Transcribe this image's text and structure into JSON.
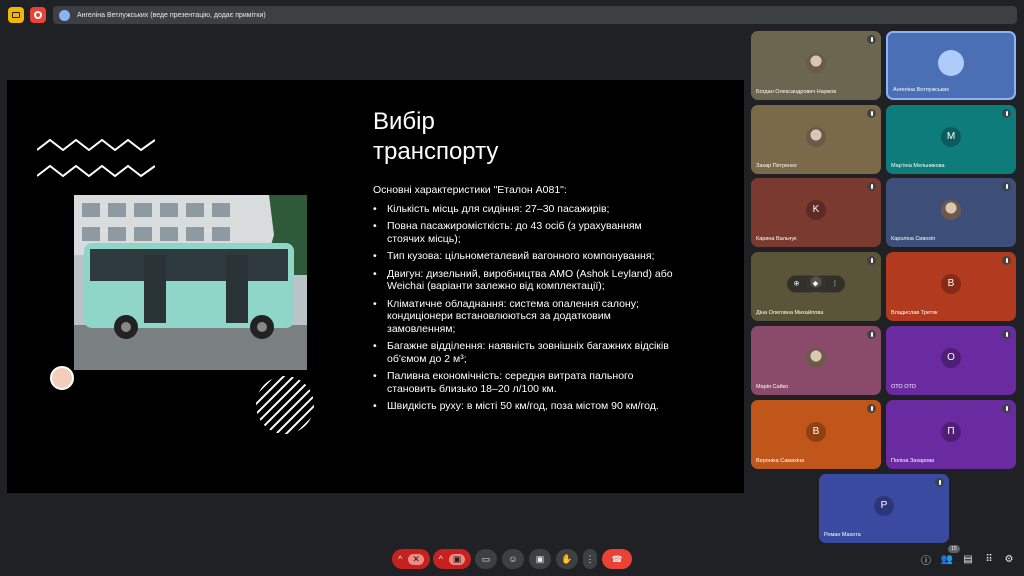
{
  "header": {
    "presenting_text": "Ангеліна Ветлужських (веде презентацію, додає примітки)"
  },
  "slide": {
    "title_line1": "Вибір",
    "title_line2": "транспорту",
    "intro": "Основні характеристики \"Еталон А081\":",
    "bullets": [
      "Кількість місць для сидіння: 27–30 пасажирів;",
      "Повна пасажиромісткість: до 43 осіб (з урахуванням стоячих місць);",
      "Тип кузова: цільнометалевий вагонного компонування;",
      "Двигун: дизельний, виробництва АМО (Ashok Leyland) або Weichai (варіанти залежно від комплектації);",
      "Кліматичне обладнання: система опалення салону; кондиціонери встановлюються за додатковим замовленням;",
      "Багажне відділення: наявність зовнішніх багажних відсіків об'ємом до 2 м³;",
      "Паливна економічність: середня витрата пального становить близько 18–20 л/100 км.",
      "Швидкість руху: в місті  50 км/год, поза містом 90 км/год."
    ]
  },
  "participants": [
    {
      "name": "Богдан Олександрович Наумов",
      "initial": "",
      "color": "#6b6650"
    },
    {
      "name": "Ангеліна Ветлужських",
      "initial": "",
      "color": "#4a6fb5"
    },
    {
      "name": "Захар Петренко",
      "initial": "",
      "color": "#7a6a4a"
    },
    {
      "name": "Мар'яна Мельникова",
      "initial": "M",
      "color": "#0f7c7c"
    },
    {
      "name": "Карина Вальчук",
      "initial": "K",
      "color": "#7b3a2f"
    },
    {
      "name": "Кароліна Сивохіп",
      "initial": "",
      "color": "#3d4f78"
    },
    {
      "name": "Діна Олеговна Михайлова",
      "initial": "",
      "color": "#5a5538"
    },
    {
      "name": "Владислав Третяк",
      "initial": "B",
      "color": "#b23a1f"
    },
    {
      "name": "Марія Сайко",
      "initial": "",
      "color": "#8a4a6a"
    },
    {
      "name": "ОТО ОТО",
      "initial": "O",
      "color": "#6a2aa0"
    },
    {
      "name": "Вероніка Самахіна",
      "initial": "B",
      "color": "#c0561a"
    },
    {
      "name": "Поліна Захарова",
      "initial": "П",
      "color": "#6a2aa0"
    },
    {
      "name": "Роман Махота",
      "initial": "P",
      "color": "#3a4aa0"
    }
  ],
  "controls": {
    "people_count": "15"
  }
}
